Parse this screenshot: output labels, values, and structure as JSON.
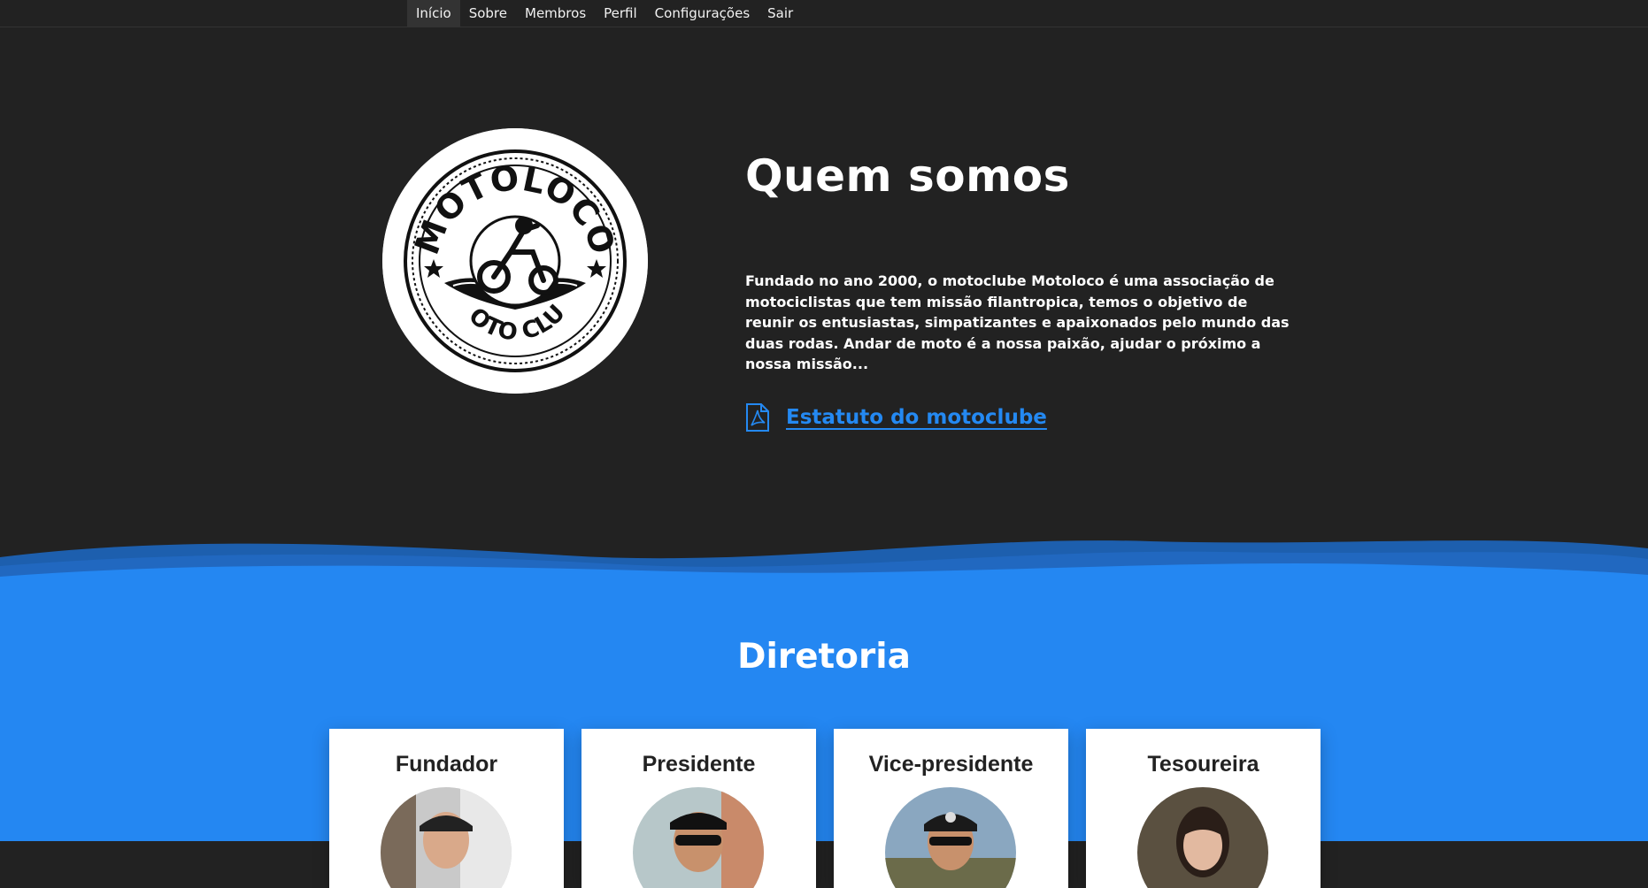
{
  "nav": {
    "items": [
      {
        "label": "Início",
        "active": true
      },
      {
        "label": "Sobre",
        "active": false
      },
      {
        "label": "Membros",
        "active": false
      },
      {
        "label": "Perfil",
        "active": false
      },
      {
        "label": "Configurações",
        "active": false
      },
      {
        "label": "Sair",
        "active": false
      }
    ]
  },
  "hero": {
    "logo": {
      "top_text": "MOTOLOCO",
      "bottom_text": "MOTO CLUB"
    },
    "title": "Quem somos",
    "description": "Fundado no ano 2000, o motoclube Motoloco é uma associação de motociclistas que tem missão filantropica, temos o objetivo de reunir os entusiastas, simpatizantes e apaixonados pelo mundo das duas rodas. Andar de moto é a nossa paixão, ajudar o próximo a nossa missão...",
    "document_link": {
      "label": "Estatuto do motoclube",
      "icon": "pdf-file-icon"
    }
  },
  "board": {
    "title": "Diretoria",
    "members": [
      {
        "role": "Fundador"
      },
      {
        "role": "Presidente"
      },
      {
        "role": "Vice-presidente"
      },
      {
        "role": "Tesoureira"
      }
    ]
  },
  "colors": {
    "background": "#222222",
    "accent": "#2487f2",
    "nav_active": "#333333",
    "card": "#ffffff"
  }
}
